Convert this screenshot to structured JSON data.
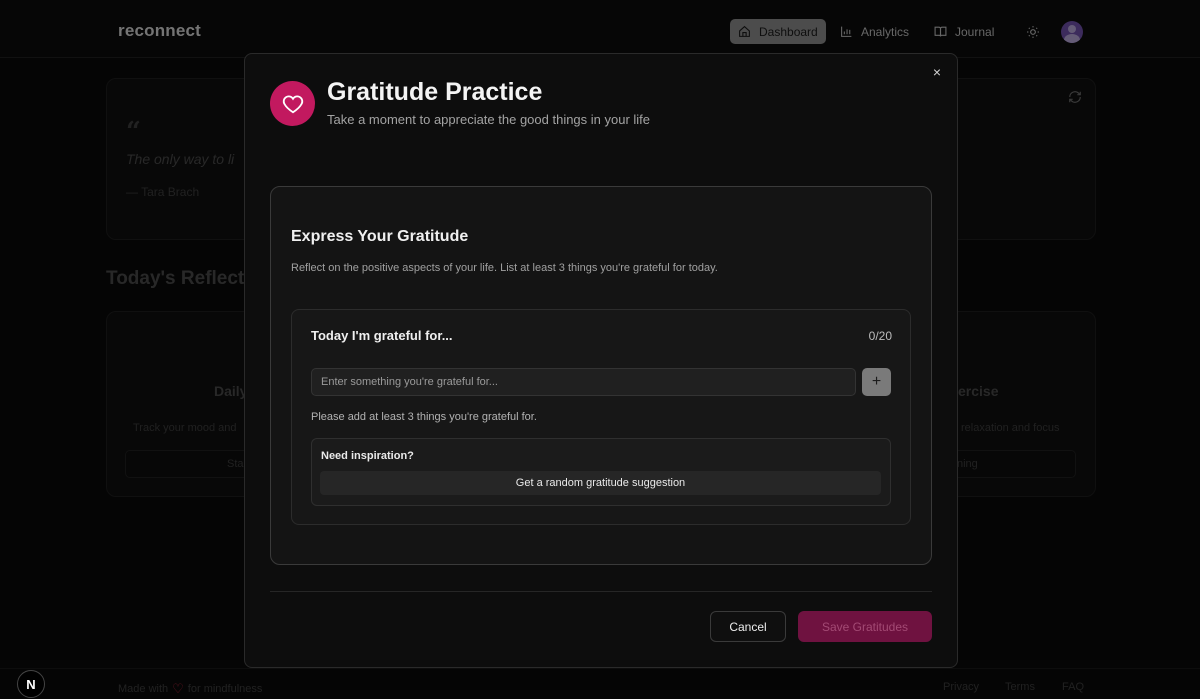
{
  "app": {
    "brand": "reconnect"
  },
  "nav": {
    "dashboard": "Dashboard",
    "analytics": "Analytics",
    "journal": "Journal"
  },
  "quote": {
    "text": "The only way to li",
    "author": "— Tara Brach"
  },
  "reflection": {
    "title": "Today's Reflect"
  },
  "feature_left": {
    "title": "Daily",
    "desc": "Track your mood and",
    "button": "Sta"
  },
  "feature_right": {
    "title": "ercise",
    "desc": "relaxation and focus",
    "button": "ning"
  },
  "modal": {
    "title": "Gratitude Practice",
    "subtitle": "Take a moment to appreciate the good things in your life",
    "close": "×"
  },
  "express": {
    "title": "Express Your Gratitude",
    "description": "Reflect on the positive aspects of your life. List at least 3 things you're grateful for today."
  },
  "list": {
    "title": "Today I'm grateful for...",
    "counter": "0/20",
    "input_placeholder": "Enter something you're grateful for...",
    "input_value": "",
    "add_label": "+",
    "hint": "Please add at least 3 things you're grateful for."
  },
  "inspiration": {
    "title": "Need inspiration?",
    "button": "Get a random gratitude suggestion"
  },
  "actions": {
    "cancel": "Cancel",
    "save": "Save Gratitudes"
  },
  "footer": {
    "made_prefix": "Made with",
    "made_suffix": "for mindfulness",
    "privacy": "Privacy",
    "terms": "Terms",
    "faq": "FAQ",
    "badge": "N"
  },
  "colors": {
    "accent": "#c2195f",
    "save_button_disabled": "#6f1240"
  }
}
